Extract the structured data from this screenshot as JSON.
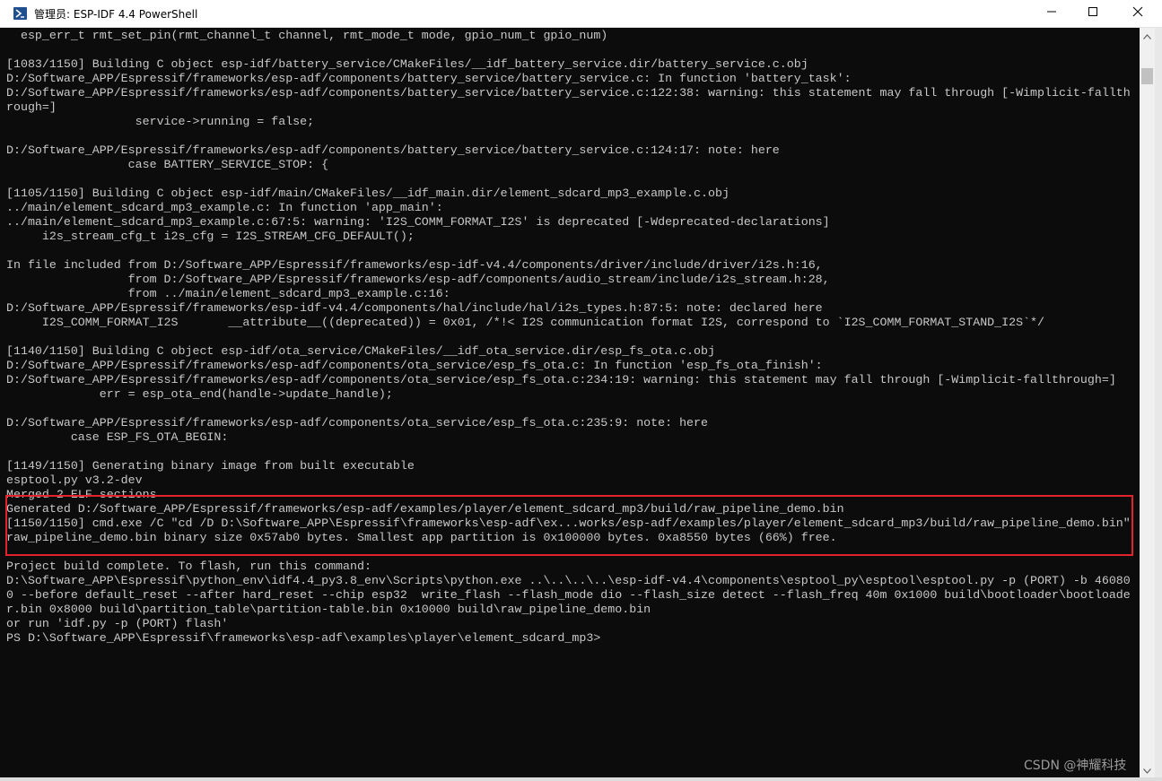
{
  "window": {
    "title": "管理员: ESP-IDF 4.4 PowerShell",
    "icon": "powershell-icon",
    "controls": [
      "minimize-icon",
      "maximize-icon",
      "close-icon"
    ]
  },
  "terminal": {
    "lines": [
      "  esp_err_t rmt_set_pin(rmt_channel_t channel, rmt_mode_t mode, gpio_num_t gpio_num)",
      "",
      "[1083/1150] Building C object esp-idf/battery_service/CMakeFiles/__idf_battery_service.dir/battery_service.c.obj",
      "D:/Software_APP/Espressif/frameworks/esp-adf/components/battery_service/battery_service.c: In function 'battery_task':",
      "D:/Software_APP/Espressif/frameworks/esp-adf/components/battery_service/battery_service.c:122:38: warning: this statement may fall through [-Wimplicit-fallth",
      "rough=]",
      "                  service->running = false;",
      "",
      "D:/Software_APP/Espressif/frameworks/esp-adf/components/battery_service/battery_service.c:124:17: note: here",
      "                 case BATTERY_SERVICE_STOP: {",
      "",
      "[1105/1150] Building C object esp-idf/main/CMakeFiles/__idf_main.dir/element_sdcard_mp3_example.c.obj",
      "../main/element_sdcard_mp3_example.c: In function 'app_main':",
      "../main/element_sdcard_mp3_example.c:67:5: warning: 'I2S_COMM_FORMAT_I2S' is deprecated [-Wdeprecated-declarations]",
      "     i2s_stream_cfg_t i2s_cfg = I2S_STREAM_CFG_DEFAULT();",
      "",
      "In file included from D:/Software_APP/Espressif/frameworks/esp-idf-v4.4/components/driver/include/driver/i2s.h:16,",
      "                 from D:/Software_APP/Espressif/frameworks/esp-adf/components/audio_stream/include/i2s_stream.h:28,",
      "                 from ../main/element_sdcard_mp3_example.c:16:",
      "D:/Software_APP/Espressif/frameworks/esp-idf-v4.4/components/hal/include/hal/i2s_types.h:87:5: note: declared here",
      "     I2S_COMM_FORMAT_I2S       __attribute__((deprecated)) = 0x01, /*!< I2S communication format I2S, correspond to `I2S_COMM_FORMAT_STAND_I2S`*/",
      "",
      "[1140/1150] Building C object esp-idf/ota_service/CMakeFiles/__idf_ota_service.dir/esp_fs_ota.c.obj",
      "D:/Software_APP/Espressif/frameworks/esp-adf/components/ota_service/esp_fs_ota.c: In function 'esp_fs_ota_finish':",
      "D:/Software_APP/Espressif/frameworks/esp-adf/components/ota_service/esp_fs_ota.c:234:19: warning: this statement may fall through [-Wimplicit-fallthrough=]",
      "             err = esp_ota_end(handle->update_handle);",
      "",
      "D:/Software_APP/Espressif/frameworks/esp-adf/components/ota_service/esp_fs_ota.c:235:9: note: here",
      "         case ESP_FS_OTA_BEGIN:",
      "",
      "[1149/1150] Generating binary image from built executable",
      "esptool.py v3.2-dev",
      "Merged 2 ELF sections",
      "Generated D:/Software_APP/Espressif/frameworks/esp-adf/examples/player/element_sdcard_mp3/build/raw_pipeline_demo.bin",
      "[1150/1150] cmd.exe /C \"cd /D D:\\Software_APP\\Espressif\\frameworks\\esp-adf\\ex...works/esp-adf/examples/player/element_sdcard_mp3/build/raw_pipeline_demo.bin\"",
      "raw_pipeline_demo.bin binary size 0x57ab0 bytes. Smallest app partition is 0x100000 bytes. 0xa8550 bytes (66%) free.",
      "",
      "Project build complete. To flash, run this command:",
      "D:\\Software_APP\\Espressif\\python_env\\idf4.4_py3.8_env\\Scripts\\python.exe ..\\..\\..\\..\\esp-idf-v4.4\\components\\esptool_py\\esptool\\esptool.py -p (PORT) -b 46080",
      "0 --before default_reset --after hard_reset --chip esp32  write_flash --flash_mode dio --flash_size detect --flash_freq 40m 0x1000 build\\bootloader\\bootloade",
      "r.bin 0x8000 build\\partition_table\\partition-table.bin 0x10000 build\\raw_pipeline_demo.bin",
      "or run 'idf.py -p (PORT) flash'",
      "PS D:\\Software_APP\\Espressif\\frameworks\\esp-adf\\examples\\player\\element_sdcard_mp3>"
    ]
  },
  "highlight": {
    "color": "#e3232c"
  },
  "watermark": "CSDN @神耀科技",
  "colors": {
    "terminal_bg": "#0c0c0c",
    "terminal_fg": "#c8c8c8",
    "titlebar_bg": "#ffffff"
  }
}
